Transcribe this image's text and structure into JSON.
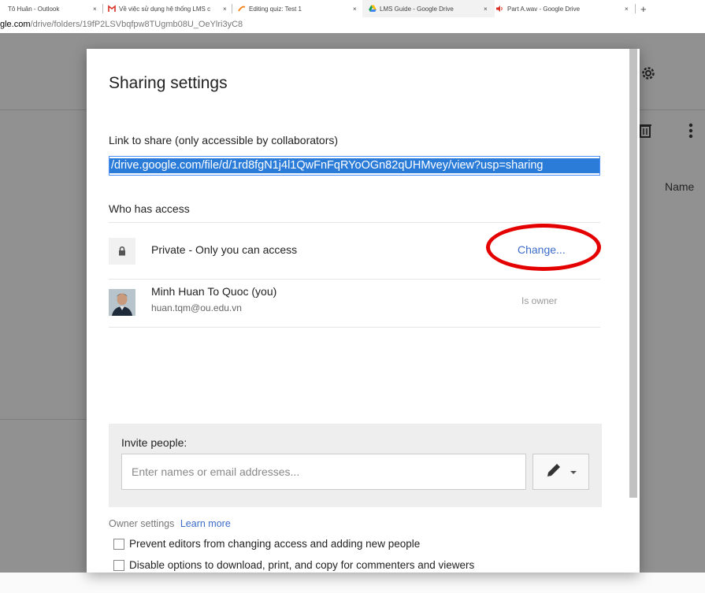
{
  "browser": {
    "tabs": [
      {
        "label": "Tô Huân - Outlook"
      },
      {
        "label": "Về việc sử dụng hệ thống LMS c"
      },
      {
        "label": "Editing quiz: Test 1"
      },
      {
        "label": "LMS Guide - Google Drive"
      },
      {
        "label": "Part A.wav - Google Drive"
      }
    ],
    "new_tab": "+",
    "close_glyph": "×",
    "url_host": "gle.com",
    "url_path": "/drive/folders/19fP2LSVbqfpw8TUgmb08U_OeYlri3yC8"
  },
  "background": {
    "name_header": "Name"
  },
  "dialog": {
    "title": "Sharing settings",
    "link_label": "Link to share (only accessible by collaborators)",
    "link_value": "/drive.google.com/file/d/1rd8fgN1j4l1QwFnFqRYoOGn82qUHMvey/view?usp=sharing",
    "who_has_access": "Who has access",
    "private_text": "Private - Only you can access",
    "change_link": "Change...",
    "user_name": "Minh Huan To Quoc (you)",
    "user_email": "huan.tqm@ou.edu.vn",
    "owner_label": "Is owner",
    "invite_label": "Invite people:",
    "invite_placeholder": "Enter names or email addresses...",
    "owner_settings_label": "Owner settings",
    "learn_more": "Learn more",
    "option_prevent": "Prevent editors from changing access and adding new people",
    "option_disable": "Disable options to download, print, and copy for commenters and viewers"
  },
  "colors": {
    "accent": "#3c6cc9",
    "highlight": "#e50000",
    "overlay": "#919191"
  }
}
